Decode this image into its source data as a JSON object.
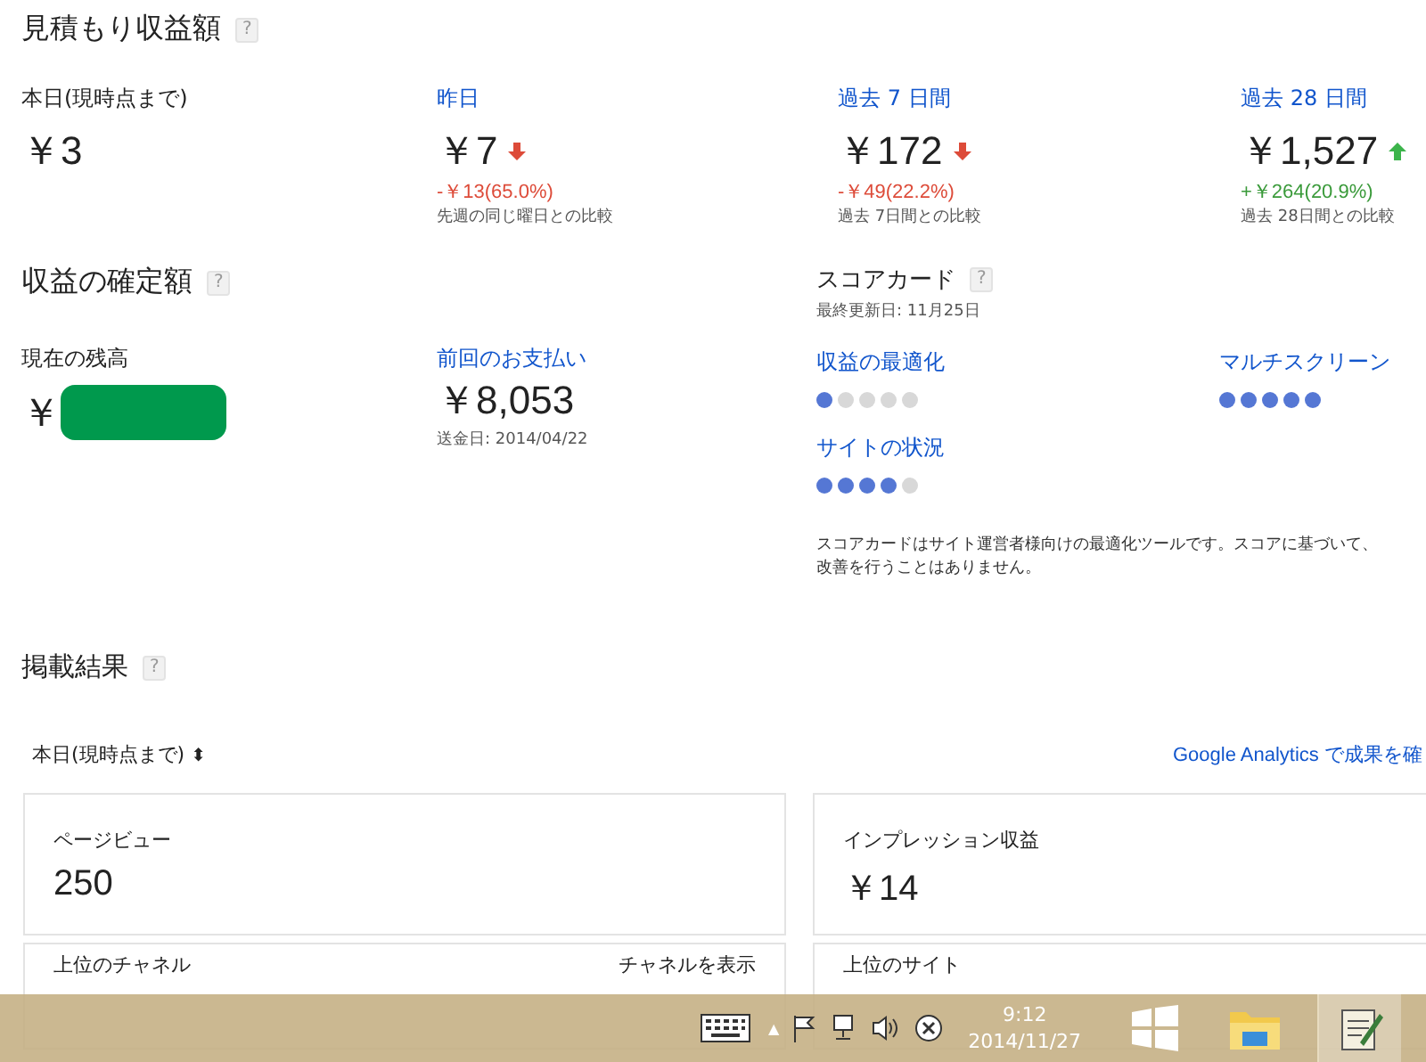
{
  "estimated": {
    "title": "見積もり収益額",
    "help": "?",
    "periods": [
      {
        "label": "本日(現時点まで)",
        "link": false,
        "amount": "￥3"
      },
      {
        "label": "昨日",
        "link": true,
        "amount": "￥7",
        "rising": false,
        "change": "-￥13(65.0%)",
        "note": "先週の同じ曜日との比較"
      },
      {
        "label": "過去 7 日間",
        "link": true,
        "amount": "￥172",
        "rising": false,
        "change": "-￥49(22.2%)",
        "note": "過去 7日間との比較"
      },
      {
        "label": "過去 28 日間",
        "link": true,
        "amount": "￥1,527",
        "rising": true,
        "change": "+￥264(20.9%)",
        "note": "過去 28日間との比較"
      }
    ]
  },
  "finalized": {
    "title": "収益の確定額",
    "help": "?",
    "balance": {
      "label": "現在の残高",
      "currency": "￥",
      "hidden": true
    },
    "last_payment": {
      "label": "前回のお支払い",
      "amount": "￥8,053",
      "note": "送金日: 2014/04/22"
    }
  },
  "scorecard": {
    "title": "スコアカード",
    "help": "?",
    "updated": "最終更新日: 11月25日",
    "items": [
      {
        "label": "収益の最適化",
        "stars": 1
      },
      {
        "label": "マルチスクリーン",
        "stars": 5
      },
      {
        "label": "サイトの状況",
        "stars": 4
      }
    ],
    "description": [
      "スコアカードはサイト運営者様向けの最適化ツールです。スコアに基づいて、",
      "改善を行うことはありません。"
    ]
  },
  "performance": {
    "title": "掲載結果",
    "help": "?",
    "range": "本日(現時点まで)",
    "range_icon": "⬍",
    "analytics_link": "Google Analytics で成果を確",
    "cards": [
      {
        "label": "ページビュー",
        "value": "250"
      },
      {
        "label": "インプレッション収益",
        "value": "￥14"
      }
    ],
    "lower": {
      "channels": "上位のチャネル",
      "channels_link": "チャネルを表示",
      "sites": "上位のサイト"
    }
  },
  "taskbar": {
    "time": "9:12",
    "date": "2014/11/27",
    "up_arrow": "▲"
  }
}
